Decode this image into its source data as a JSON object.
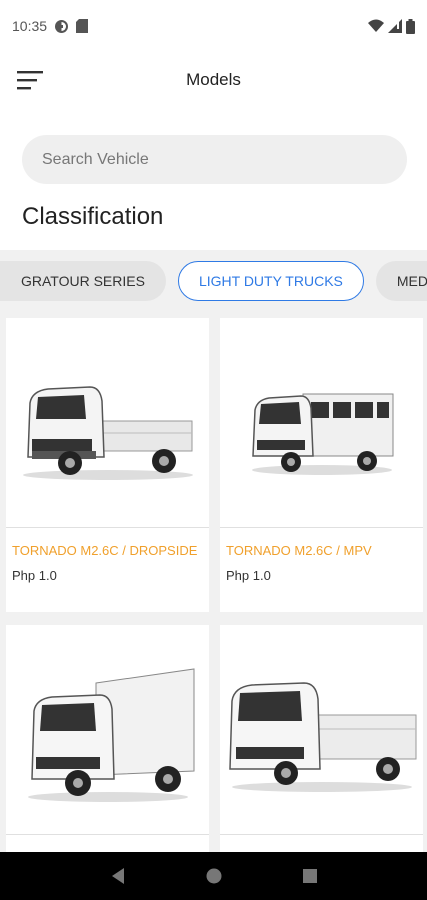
{
  "status_bar": {
    "time": "10:35"
  },
  "app_bar": {
    "title": "Models"
  },
  "search": {
    "placeholder": "Search Vehicle"
  },
  "section": {
    "title": "Classification"
  },
  "chips": [
    {
      "label": "GRATOUR SERIES",
      "active": false
    },
    {
      "label": "LIGHT DUTY TRUCKS",
      "active": true
    },
    {
      "label": "MEDI",
      "active": false
    }
  ],
  "vehicles": [
    {
      "name": "TORNADO M2.6C / DROPSIDE",
      "price": "Php 1.0",
      "image": "truck-dropside-icon"
    },
    {
      "name": "TORNADO M2.6C / MPV",
      "price": "Php 1.0",
      "image": "truck-mpv-icon"
    },
    {
      "name": "",
      "price": "",
      "image": "truck-box-van-icon"
    },
    {
      "name": "",
      "price": "",
      "image": "truck-cargo-icon"
    }
  ],
  "colors": {
    "accent": "#2f7ae5",
    "product_name": "#f0a02c",
    "strip_bg": "#f1f1f1"
  }
}
